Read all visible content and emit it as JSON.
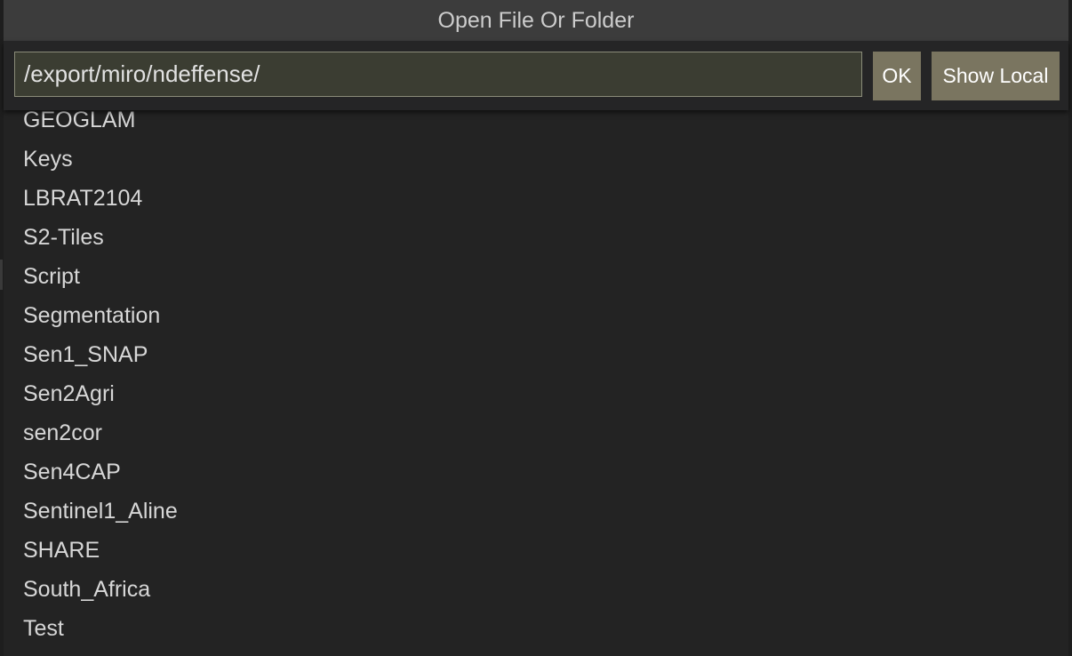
{
  "dialog": {
    "title": "Open File Or Folder",
    "path_value": "/export/miro/ndeffense/",
    "ok_label": "OK",
    "show_local_label": "Show Local"
  },
  "items": [
    "GEOGLAM",
    "Keys",
    "LBRAT2104",
    "S2-Tiles",
    "Script",
    "Segmentation",
    "Sen1_SNAP",
    "Sen2Agri",
    "sen2cor",
    "Sen4CAP",
    "Sentinel1_Aline",
    "SHARE",
    "South_Africa",
    "Test"
  ],
  "colors": {
    "title_bar": "#3c3c3c",
    "button": "#7a7560",
    "input_bg": "#3b3d32",
    "list_bg": "#232323"
  }
}
